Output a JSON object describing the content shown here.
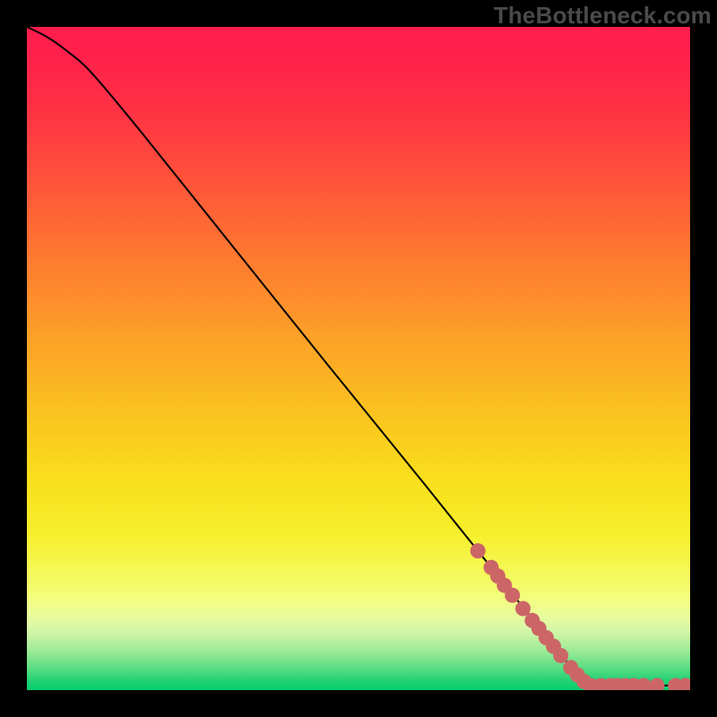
{
  "watermark": "TheBottleneck.com",
  "chart_data": {
    "type": "line",
    "title": "",
    "xlabel": "",
    "ylabel": "",
    "xlim": [
      0,
      100
    ],
    "ylim": [
      0,
      100
    ],
    "curve": {
      "name": "bottleneck-curve",
      "points_xy": [
        [
          0,
          100
        ],
        [
          3,
          98.5
        ],
        [
          6,
          96.4
        ],
        [
          10,
          92.8
        ],
        [
          18,
          83.2
        ],
        [
          30,
          68.2
        ],
        [
          45,
          49.5
        ],
        [
          60,
          31.0
        ],
        [
          72,
          16.0
        ],
        [
          80,
          6.0
        ],
        [
          84,
          1.2
        ],
        [
          85,
          0.7
        ],
        [
          90,
          0.7
        ],
        [
          95,
          0.7
        ],
        [
          100,
          0.7
        ]
      ]
    },
    "markers": {
      "name": "highlight-points",
      "points_xy": [
        [
          68,
          21.0
        ],
        [
          70,
          18.5
        ],
        [
          71,
          17.2
        ],
        [
          72,
          15.8
        ],
        [
          73.2,
          14.3
        ],
        [
          74.8,
          12.3
        ],
        [
          76.2,
          10.5
        ],
        [
          77.2,
          9.3
        ],
        [
          78.3,
          7.9
        ],
        [
          79.4,
          6.6
        ],
        [
          80.5,
          5.2
        ],
        [
          82.0,
          3.4
        ],
        [
          83.0,
          2.3
        ],
        [
          84.0,
          1.3
        ],
        [
          85.0,
          0.7
        ],
        [
          86.5,
          0.7
        ],
        [
          88.0,
          0.7
        ],
        [
          89.0,
          0.7
        ],
        [
          90.2,
          0.7
        ],
        [
          91.5,
          0.7
        ],
        [
          93.0,
          0.7
        ],
        [
          95.0,
          0.7
        ],
        [
          97.8,
          0.7
        ],
        [
          99.3,
          0.7
        ]
      ]
    },
    "colors": {
      "curve_stroke": "#000000",
      "marker_fill": "#cc6666",
      "gradient_stops": [
        {
          "offset": 0.0,
          "color": "#ff1d4d"
        },
        {
          "offset": 0.05,
          "color": "#ff224b"
        },
        {
          "offset": 0.12,
          "color": "#ff3044"
        },
        {
          "offset": 0.22,
          "color": "#ff4f3b"
        },
        {
          "offset": 0.34,
          "color": "#fe7731"
        },
        {
          "offset": 0.46,
          "color": "#fc9e28"
        },
        {
          "offset": 0.58,
          "color": "#fac220"
        },
        {
          "offset": 0.68,
          "color": "#f9de1c"
        },
        {
          "offset": 0.76,
          "color": "#f6ee2a"
        },
        {
          "offset": 0.82,
          "color": "#f5f856"
        },
        {
          "offset": 0.86,
          "color": "#f3fe7c"
        },
        {
          "offset": 0.88,
          "color": "#edfc93"
        },
        {
          "offset": 0.895,
          "color": "#e5faa1"
        },
        {
          "offset": 0.905,
          "color": "#daf8a7"
        },
        {
          "offset": 0.915,
          "color": "#cdf4a5"
        },
        {
          "offset": 0.925,
          "color": "#baf0a0"
        },
        {
          "offset": 0.935,
          "color": "#a7ed9a"
        },
        {
          "offset": 0.945,
          "color": "#91e893"
        },
        {
          "offset": 0.955,
          "color": "#79e38c"
        },
        {
          "offset": 0.965,
          "color": "#5fde84"
        },
        {
          "offset": 0.975,
          "color": "#42d87d"
        },
        {
          "offset": 0.985,
          "color": "#24d275"
        },
        {
          "offset": 1.0,
          "color": "#05ce6e"
        }
      ],
      "background_black": "#000000"
    }
  }
}
